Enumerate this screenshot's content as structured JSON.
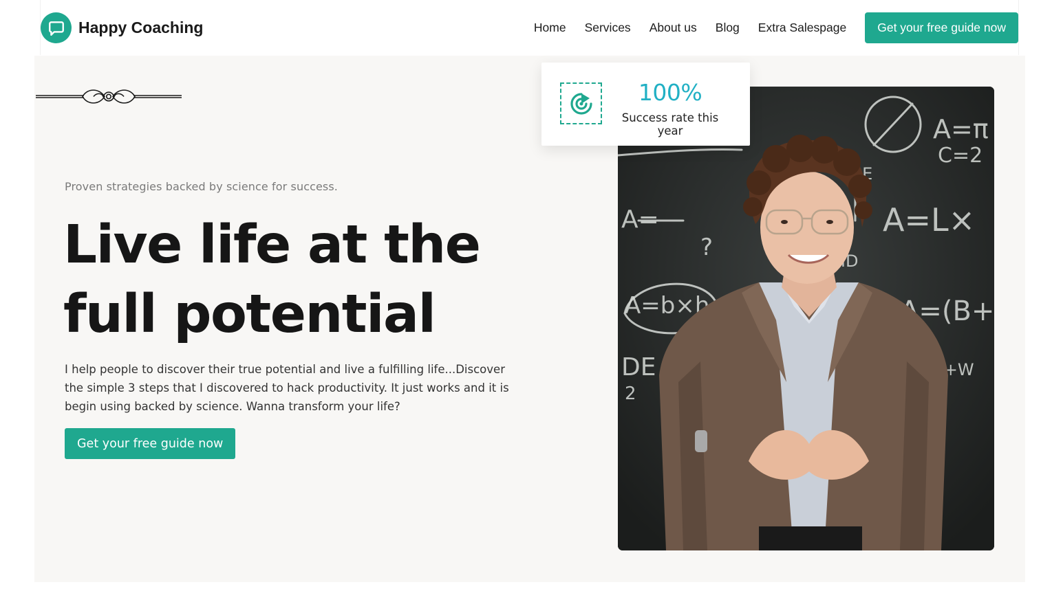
{
  "brand": {
    "name": "Happy Coaching",
    "logo_icon": "chat-bubble-icon",
    "accent_color": "#1fa88f"
  },
  "nav": {
    "items": [
      {
        "label": "Home"
      },
      {
        "label": "Services"
      },
      {
        "label": "About us"
      },
      {
        "label": "Blog"
      },
      {
        "label": "Extra Salespage"
      }
    ],
    "cta_label": "Get your free guide now"
  },
  "hero": {
    "tagline": "Proven strategies backed by science for success.",
    "headline_line1": "Live life at the",
    "headline_line2": "full potential",
    "intro": "I help people to discover their true potential and live a fulfilling life...Discover the simple 3 steps that I discovered to hack productivity. It just works and it is begin using backed by science. Wanna transform your life?",
    "cta_label": "Get your free guide now",
    "ornament_icon": "decorative-flourish-icon"
  },
  "stat": {
    "icon": "target-icon",
    "value": "100%",
    "label": "Success rate this year",
    "value_color": "#21b0c4"
  },
  "photo": {
    "blackboard_text": [
      "A=π",
      "C=2",
      "CLE",
      "A=L×",
      "OID",
      "A=b×h",
      "A=(B+",
      "DE",
      "W+W",
      "A=",
      "2",
      "?"
    ]
  }
}
